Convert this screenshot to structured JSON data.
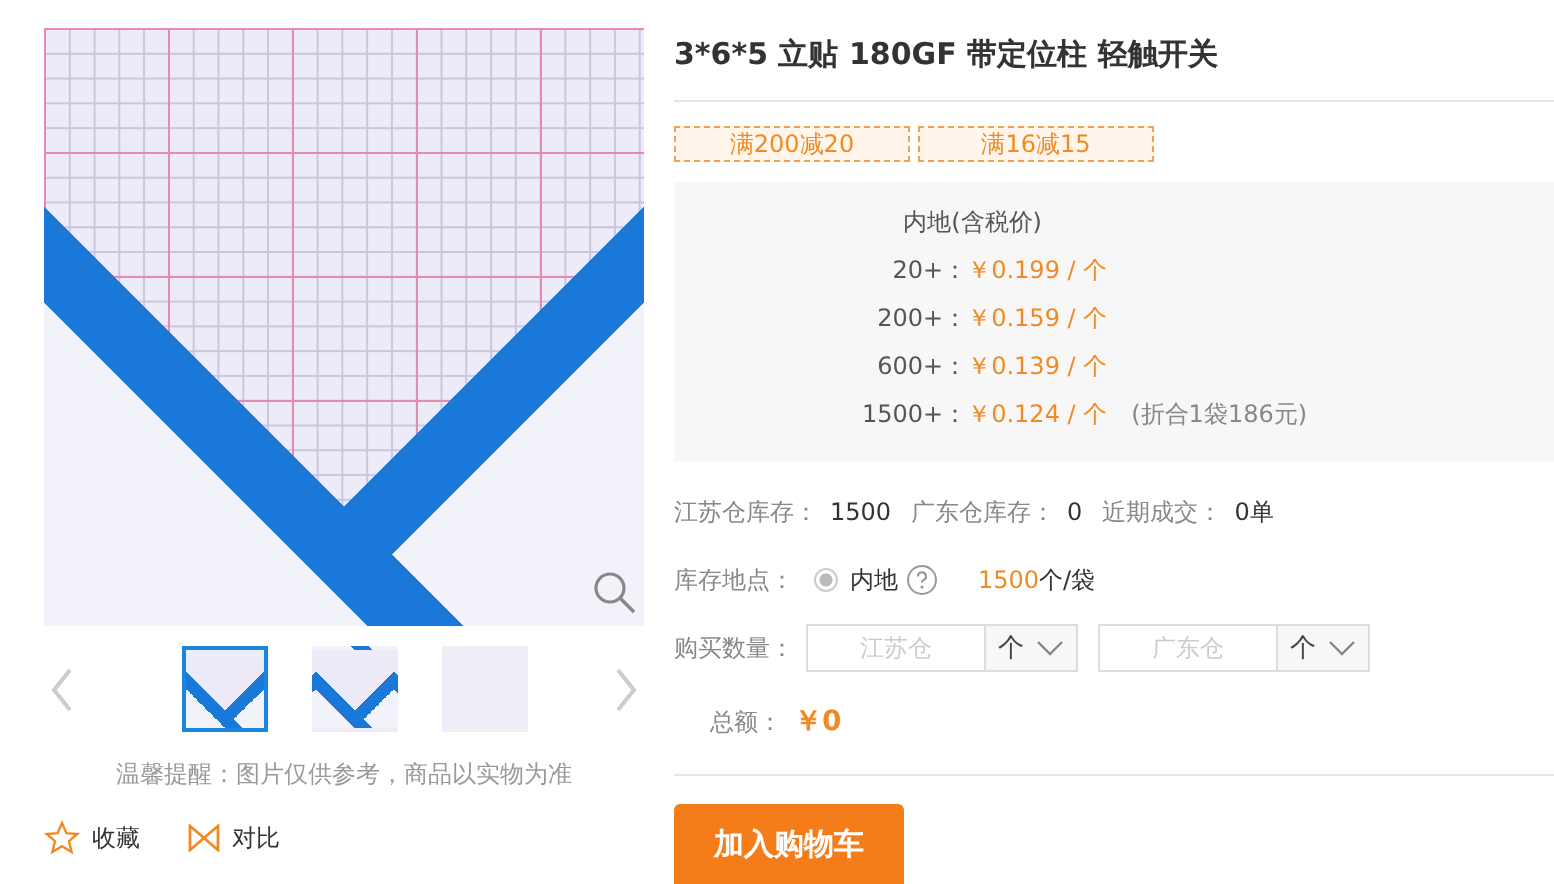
{
  "gallery": {
    "thumbnails": [
      {
        "selected": true
      },
      {
        "selected": false
      },
      {
        "selected": false
      }
    ],
    "notice": "温馨提醒：图片仅供参考，商品以实物为准",
    "actions": [
      {
        "kind": "favorite",
        "label": "收藏"
      },
      {
        "kind": "compare",
        "label": "对比"
      }
    ]
  },
  "product": {
    "title": "3*6*5 立贴 180GF 带定位柱 轻触开关",
    "coupons": [
      "满200减20",
      "满16减15"
    ],
    "price_table": {
      "heading": "内地(含税价)",
      "tiers": [
        {
          "qty": "20+：",
          "price": "￥0.199 / 个"
        },
        {
          "qty": "200+：",
          "price": "￥0.159 / 个"
        },
        {
          "qty": "600+：",
          "price": "￥0.139 / 个"
        },
        {
          "qty": "1500+：",
          "price": "￥0.124 / 个",
          "note": "(折合1袋186元)"
        }
      ]
    },
    "stock": [
      {
        "label": "江苏仓库存：",
        "value": "1500"
      },
      {
        "label": "广东仓库存：",
        "value": "0"
      },
      {
        "label": "近期成交：",
        "value": "0单"
      }
    ],
    "location": {
      "label": "库存地点：",
      "options": [
        {
          "label": "内地",
          "checked": true
        }
      ],
      "pack_qty": "1500",
      "pack_unit": "个/袋"
    },
    "quantity": {
      "label": "购买数量：",
      "fields": [
        {
          "placeholder": "江苏仓",
          "unit": "个"
        },
        {
          "placeholder": "广东仓",
          "unit": "个"
        }
      ]
    },
    "total": {
      "label": "总额：",
      "value": "￥0"
    },
    "add_to_cart": "加入购物车"
  }
}
